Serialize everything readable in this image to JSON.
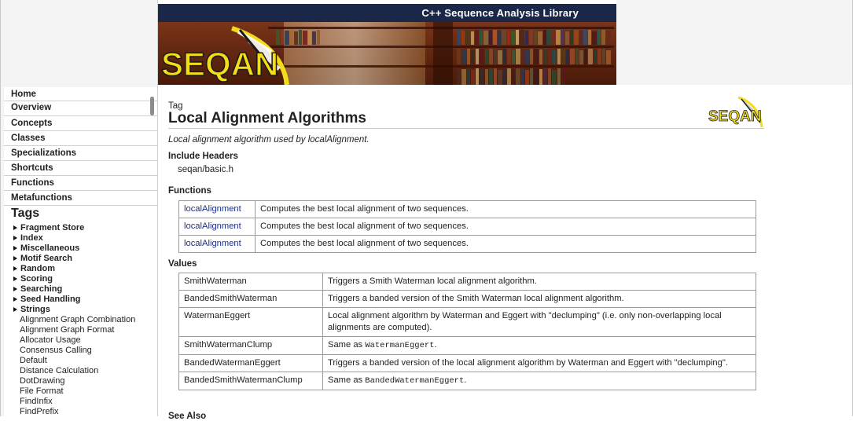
{
  "banner": {
    "tagline": "C++ Sequence Analysis Library",
    "logo_text": "SEQAN"
  },
  "sidebar": {
    "nav": [
      {
        "label": "Home"
      },
      {
        "label": "Overview"
      },
      {
        "label": "Concepts"
      },
      {
        "label": "Classes"
      },
      {
        "label": "Specializations"
      },
      {
        "label": "Shortcuts"
      },
      {
        "label": "Functions"
      },
      {
        "label": "Metafunctions"
      }
    ],
    "tags_title": "Tags",
    "tag_folders": [
      {
        "label": "Fragment Store"
      },
      {
        "label": "Index"
      },
      {
        "label": "Miscellaneous"
      },
      {
        "label": "Motif Search"
      },
      {
        "label": "Random"
      },
      {
        "label": "Scoring"
      },
      {
        "label": "Searching"
      },
      {
        "label": "Seed Handling"
      },
      {
        "label": "Strings"
      }
    ],
    "tag_items": [
      {
        "label": "Alignment Graph Combination"
      },
      {
        "label": "Alignment Graph Format"
      },
      {
        "label": "Allocator Usage"
      },
      {
        "label": "Consensus Calling"
      },
      {
        "label": "Default"
      },
      {
        "label": "Distance Calculation"
      },
      {
        "label": "DotDrawing"
      },
      {
        "label": "File Format"
      },
      {
        "label": "FindInfix"
      },
      {
        "label": "FindPrefix"
      }
    ]
  },
  "page": {
    "kind": "Tag",
    "title": "Local Alignment Algorithms",
    "description": "Local alignment algorithm used by localAlignment.",
    "include_heading": "Include Headers",
    "include_value": "seqan/basic.h",
    "functions_heading": "Functions",
    "functions": [
      {
        "name": "localAlignment",
        "desc": "Computes the best local alignment of two sequences."
      },
      {
        "name": "localAlignment",
        "desc": "Computes the best local alignment of two sequences."
      },
      {
        "name": "localAlignment",
        "desc": "Computes the best local alignment of two sequences."
      }
    ],
    "values_heading": "Values",
    "values": [
      {
        "name": "SmithWaterman",
        "desc": "Triggers a Smith Waterman local alignment algorithm."
      },
      {
        "name": "BandedSmithWaterman",
        "desc": "Triggers a banded version of the Smith Waterman local alignment algorithm."
      },
      {
        "name": "WatermanEggert",
        "desc": "Local alignment algorithm by Waterman and Eggert with \"declumping\" (i.e. only non-overlapping local alignments are computed)."
      },
      {
        "name": "SmithWatermanClump",
        "desc_prefix": "Same as",
        "desc_code": "WatermanEggert",
        "desc_suffix": "."
      },
      {
        "name": "BandedWatermanEggert",
        "desc": "Triggers a banded version of the local alignment algorithm by Waterman and Eggert with \"declumping\"."
      },
      {
        "name": "BandedSmithWatermanClump",
        "desc_prefix": "Same as",
        "desc_code": "BandedWatermanEggert",
        "desc_suffix": "."
      }
    ],
    "next_heading": "See Also"
  },
  "colors": {
    "banner_bar": "#1a2748",
    "link": "#1a2d8a",
    "logo_yellow": "#f3dc1a"
  }
}
